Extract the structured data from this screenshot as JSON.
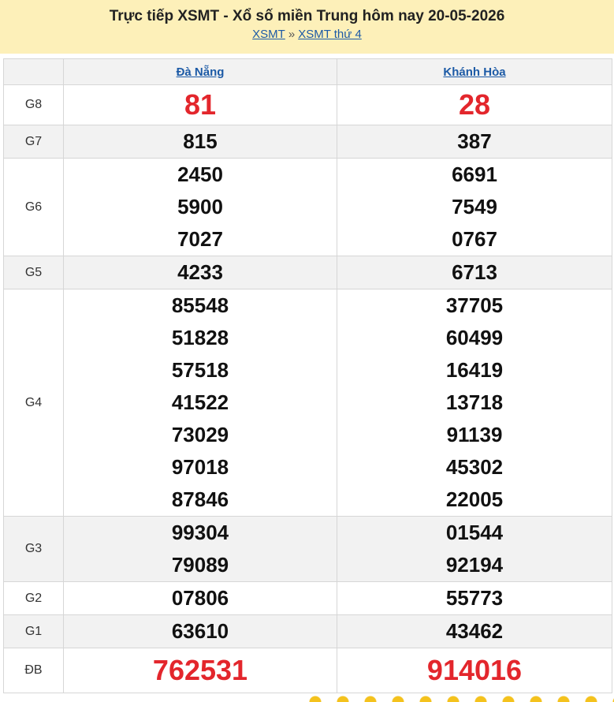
{
  "header": {
    "title": "Trực tiếp XSMT - Xổ số miền Trung hôm nay 20-05-2026",
    "breadcrumb": [
      {
        "label": "XSMT"
      },
      {
        "label": "XSMT thứ 4"
      }
    ],
    "separator": "»"
  },
  "table": {
    "provinces": [
      "Đà Nẵng",
      "Khánh Hòa"
    ],
    "rows": [
      {
        "prize": "G8",
        "cols": [
          [
            "81"
          ],
          [
            "28"
          ]
        ]
      },
      {
        "prize": "G7",
        "cols": [
          [
            "815"
          ],
          [
            "387"
          ]
        ]
      },
      {
        "prize": "G6",
        "cols": [
          [
            "2450",
            "5900",
            "7027"
          ],
          [
            "6691",
            "7549",
            "0767"
          ]
        ]
      },
      {
        "prize": "G5",
        "cols": [
          [
            "4233"
          ],
          [
            "6713"
          ]
        ]
      },
      {
        "prize": "G4",
        "cols": [
          [
            "85548",
            "51828",
            "57518",
            "41522",
            "73029",
            "97018",
            "87846"
          ],
          [
            "37705",
            "60499",
            "16419",
            "13718",
            "91139",
            "45302",
            "22005"
          ]
        ]
      },
      {
        "prize": "G3",
        "cols": [
          [
            "99304",
            "79089"
          ],
          [
            "01544",
            "92194"
          ]
        ]
      },
      {
        "prize": "G2",
        "cols": [
          [
            "07806"
          ],
          [
            "55773"
          ]
        ]
      },
      {
        "prize": "G1",
        "cols": [
          [
            "63610"
          ],
          [
            "43462"
          ]
        ]
      },
      {
        "prize": "ĐB",
        "cols": [
          [
            "762531"
          ],
          [
            "914016"
          ]
        ]
      }
    ]
  },
  "colors": {
    "header_bg": "#fdf0b9",
    "link": "#1c5aa6",
    "highlight_red": "#e3262c",
    "row_alt_bg": "#f2f2f2",
    "dot_yellow": "#f4c21d"
  }
}
